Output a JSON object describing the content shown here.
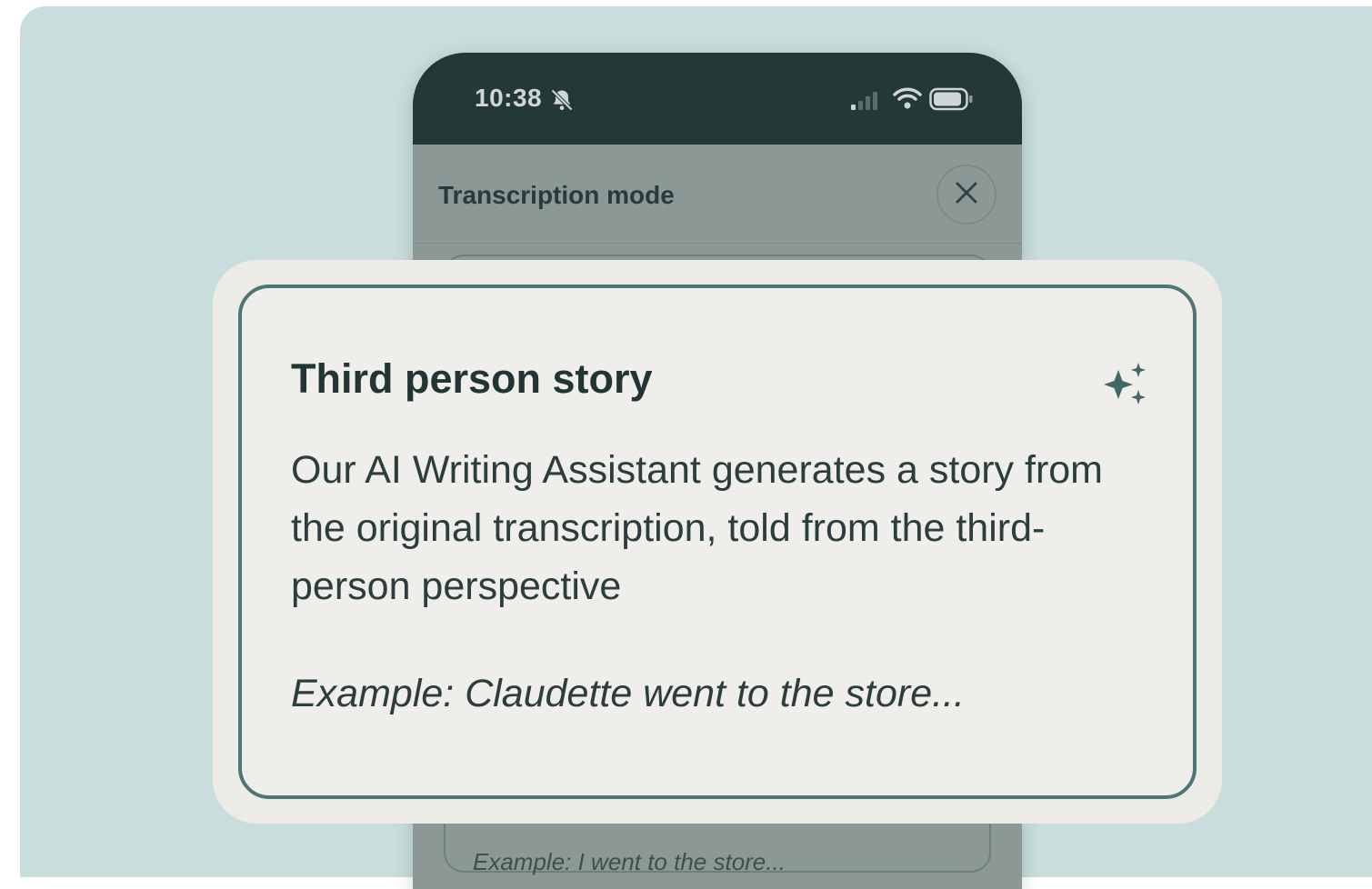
{
  "status_bar": {
    "time": "10:38",
    "icons": [
      "bell-off-icon",
      "signal-icon",
      "wifi-icon",
      "battery-icon"
    ]
  },
  "sheet": {
    "title": "Transcription mode",
    "close_icon": "close-icon",
    "behind_example": "Example: I went to the store..."
  },
  "popup": {
    "title": "Third person story",
    "icon": "sparkle-icon",
    "description": "Our AI Writing Assistant generates a story from the original transcription, told from the third-person perspective",
    "example": "Example: Claudette went to the store..."
  },
  "colors": {
    "backdrop": "#c9dddd",
    "status_bar": "#253838",
    "dimmed_sheet": "#8c9895",
    "card_border": "#4e7675",
    "card_bg": "#efeeea",
    "accent": "#3f6766"
  }
}
